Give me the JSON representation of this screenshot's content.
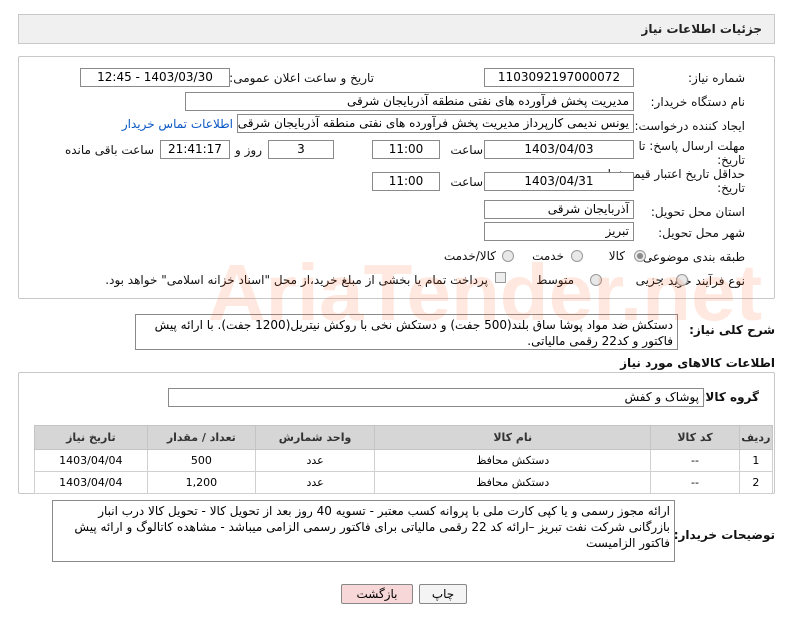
{
  "header": {
    "title": "جزئیات اطلاعات نیاز"
  },
  "form": {
    "need_number_label": "شماره نیاز:",
    "need_number": "1103092197000072",
    "announce_label": "تاریخ و ساعت اعلان عمومی:",
    "announce_value": "1403/03/30 - 12:45",
    "buyer_org_label": "نام دستگاه خریدار:",
    "buyer_org": "مدیریت پخش فرآورده های نفتی منطقه آذربایجان شرقی",
    "creator_label": "ایجاد کننده درخواست:",
    "creator": "یونس ندیمی کارپرداز مدیریت پخش فرآورده های نفتی منطقه آذربایجان شرقی",
    "contact_link": "اطلاعات تماس خریدار",
    "deadline_label_1": "مهلت ارسال پاسخ: تا",
    "deadline_label_2": "تاریخ:",
    "deadline_date": "1403/04/03",
    "time_label": "ساعت",
    "deadline_time": "11:00",
    "days_value": "3",
    "days_label": "روز و",
    "remaining_time": "21:41:17",
    "remaining_label": "ساعت باقی مانده",
    "validity_label_1": "حداقل تاریخ اعتبار قیمت: تا",
    "validity_label_2": "تاریخ:",
    "validity_date": "1403/04/31",
    "validity_time": "11:00",
    "province_label": "استان محل تحویل:",
    "province": "آذربایجان شرقی",
    "city_label": "شهر محل تحویل:",
    "city": "تبریز",
    "category_label": "طبقه بندی موضوعی:",
    "category_options": [
      "کالا",
      "خدمت",
      "کالا/خدمت"
    ],
    "process_label": "نوع فرآیند خرید :",
    "process_options": [
      "جزیی",
      "متوسط"
    ],
    "payment_note": "پرداخت تمام یا بخشی از مبلغ خرید،از محل \"اسناد خزانه اسلامی\" خواهد بود.",
    "summary_label": "شرح کلی نیاز:",
    "summary_text": "دستکش ضد مواد پوشا ساق بلند(500 جفت) و دستکش نخی با روکش نیتریل(1200 جفت). با ارائه پیش فاکتور و کد22 رقمی مالیاتی."
  },
  "goods": {
    "section_title": "اطلاعات کالاهای مورد نیاز",
    "group_label": "گروه کالا:",
    "group_value": "پوشاک و کفش",
    "columns": [
      "ردیف",
      "کد کالا",
      "نام کالا",
      "واحد شمارش",
      "تعداد / مقدار",
      "تاریخ نیاز"
    ],
    "rows": [
      [
        "1",
        "--",
        "دستکش محافظ",
        "عدد",
        "500",
        "1403/04/04"
      ],
      [
        "2",
        "--",
        "دستکش محافظ",
        "عدد",
        "1,200",
        "1403/04/04"
      ]
    ]
  },
  "buyer_notes": {
    "label": "توضیحات خریدار:",
    "text": "ارائه مجوز رسمی و یا کپی کارت ملی با پروانه کسب معتبر - تسویه 40 روز بعد از تحویل کالا - تحویل کالا درب انبار بازرگانی شرکت نفت تبریز –ارائه کد 22 رقمی مالیاتی برای فاکتور رسمی الزامی میباشد - مشاهده کاتالوگ و ارائه پیش فاکتور الزامیست"
  },
  "buttons": {
    "print": "چاپ",
    "back": "بازگشت"
  },
  "watermark": {
    "text": "AriaTender.net"
  },
  "colors": {
    "link": "#0b57c5",
    "back_button_bg": "#f7d7d7",
    "header_bg": "#d6d6d6"
  }
}
